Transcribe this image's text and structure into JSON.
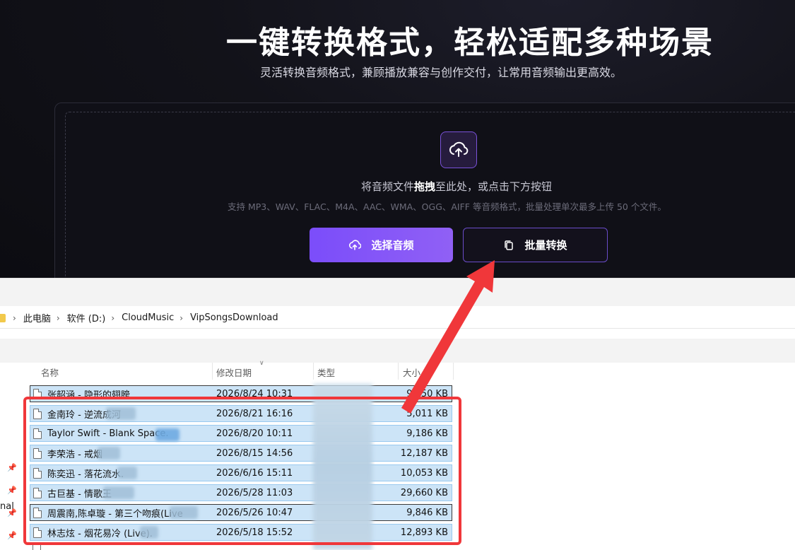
{
  "hero": {
    "title": "一键转换格式，轻松适配多种场景",
    "subtitle": "灵活转换音频格式，兼顾播放兼容与创作交付，让常用音频输出更高效。"
  },
  "dropzone": {
    "text_before": "将音频文件",
    "text_bold": "拖拽",
    "text_after": "至此处，或点击下方按钮",
    "hint": "支持 MP3、WAV、FLAC、M4A、AAC、WMA、OGG、AIFF 等音频格式，批量处理单次最多上传 50 个文件。",
    "upload_icon": "cloud-upload-icon"
  },
  "buttons": {
    "select_audio": "选择音频",
    "batch_convert": "批量转换"
  },
  "explorer": {
    "breadcrumb": [
      "此电脑",
      "软件 (D:)",
      "CloudMusic",
      "VipSongsDownload"
    ],
    "columns": {
      "name": "名称",
      "date": "修改日期",
      "type": "类型",
      "size": "大小"
    },
    "nav_label": "nal",
    "files": [
      {
        "name": "张韶涵 - 隐形的翅膀.",
        "date": "2026/8/24 10:31",
        "size": "9,150 KB"
      },
      {
        "name": "金南玲 - 逆流成河",
        "date": "2026/8/21 16:16",
        "size": "5,011 KB"
      },
      {
        "name": "Taylor Swift - Blank Space.",
        "date": "2026/8/20 10:11",
        "size": "9,186 KB"
      },
      {
        "name": "李荣浩 - 戒烟",
        "date": "2026/8/15 14:56",
        "size": "12,187 KB"
      },
      {
        "name": "陈奕迅 - 落花流水.",
        "date": "2026/6/16 15:11",
        "size": "10,053 KB"
      },
      {
        "name": "古巨基 - 情歌王",
        "date": "2026/5/28 11:03",
        "size": "29,660 KB"
      },
      {
        "name": "周震南,陈卓璇 - 第三个吻痕(Live",
        "date": "2026/5/26 10:47",
        "size": "9,846 KB"
      },
      {
        "name": "林志炫 - 烟花易冷 (Live).",
        "date": "2026/5/18 15:52",
        "size": "12,893 KB"
      }
    ],
    "partial_row": {
      "name": "",
      "date": "",
      "size": ""
    }
  },
  "colors": {
    "accent_purple": "#7b4dfa",
    "selection_blue": "#cce4f7",
    "annotation_red": "#f0373a"
  }
}
